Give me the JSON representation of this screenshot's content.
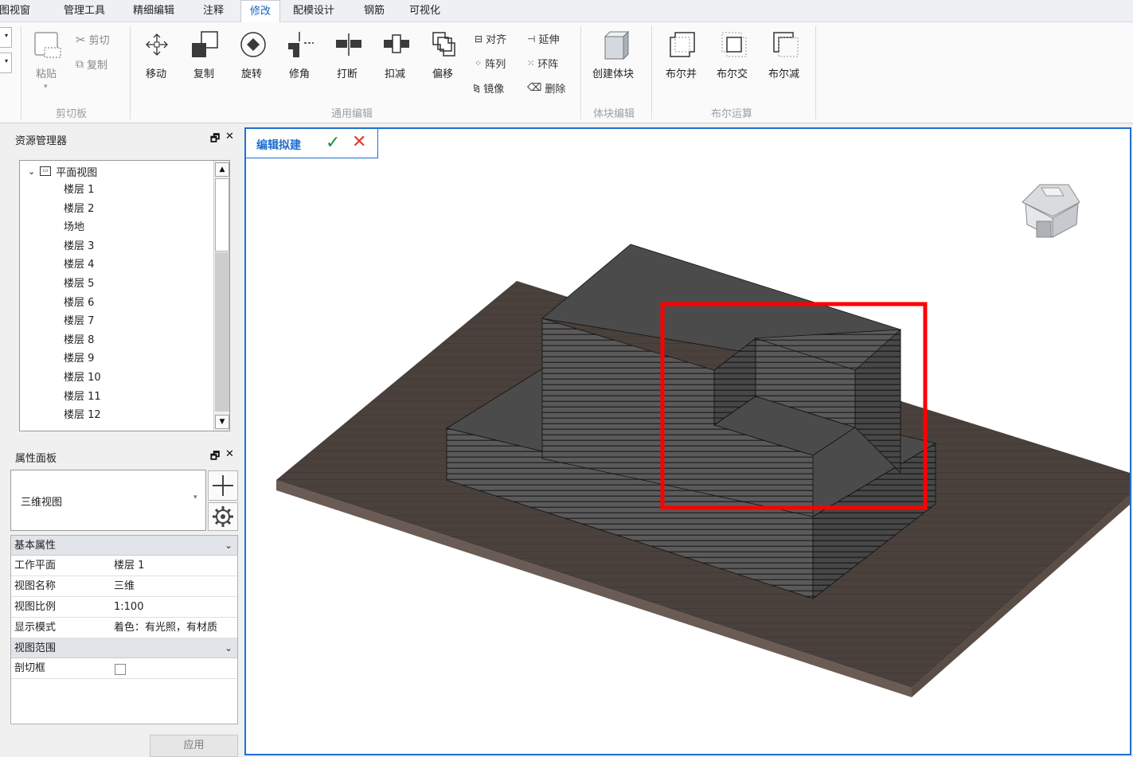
{
  "menu": {
    "items": [
      {
        "label": "视图视窗"
      },
      {
        "label": "管理工具"
      },
      {
        "label": "精细编辑"
      },
      {
        "label": "注释"
      },
      {
        "label": "修改"
      },
      {
        "label": "配模设计"
      },
      {
        "label": "钢筋"
      },
      {
        "label": "可视化"
      }
    ]
  },
  "ribbon": {
    "clipboard": {
      "paste": "粘贴",
      "cut": "剪切",
      "copy": "复制",
      "group": "剪切板"
    },
    "edit": {
      "move": "移动",
      "duplicate": "复制",
      "rotate": "旋转",
      "trim": "修角",
      "break": "打断",
      "subtract": "扣减",
      "offset": "偏移",
      "align": "对齐",
      "extend": "延伸",
      "array": "阵列",
      "ring_array": "环阵",
      "mirror": "镜像",
      "delete": "删除",
      "group": "通用编辑"
    },
    "block": {
      "create": "创建体块",
      "group": "体块编辑"
    },
    "boolean": {
      "union": "布尔并",
      "intersect": "布尔交",
      "difference": "布尔减",
      "group": "布尔运算"
    }
  },
  "resource_manager": {
    "title": "资源管理器",
    "root": "平面视图",
    "items": [
      "楼层 1",
      "楼层 2",
      "场地",
      "楼层 3",
      "楼层 4",
      "楼层 5",
      "楼层 6",
      "楼层 7",
      "楼层 8",
      "楼层 9",
      "楼层 10",
      "楼层 11",
      "楼层 12"
    ]
  },
  "properties": {
    "title": "属性面板",
    "type": "三维视图",
    "groups": [
      {
        "name": "基本属性",
        "rows": [
          {
            "key": "工作平面",
            "value": "楼层 1"
          },
          {
            "key": "视图名称",
            "value": "三维"
          },
          {
            "key": "视图比例",
            "value": "1:100"
          },
          {
            "key": "显示模式",
            "value": "着色：有光照，有材质"
          }
        ]
      },
      {
        "name": "视图范围",
        "rows": [
          {
            "key": "剖切框",
            "value": ""
          }
        ]
      }
    ],
    "apply": "应用"
  },
  "viewport": {
    "edit_mode": "编辑拟建",
    "confirm": "✓",
    "cancel": "✕"
  },
  "colors": {
    "accent": "#1f6fd0",
    "highlight": "#ff0000",
    "ground": "#4a413c",
    "block": "#4b4b4b"
  }
}
